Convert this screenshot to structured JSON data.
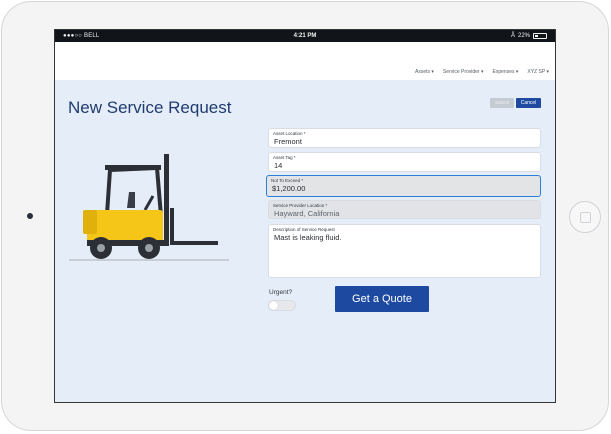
{
  "status_bar": {
    "carrier": "●●●○○ BELL",
    "time": "4:21 PM",
    "battery": "22%"
  },
  "nav": {
    "items": [
      "Assets",
      "Service Provider",
      "Expenses",
      "XYZ SP"
    ]
  },
  "page": {
    "title": "New Service Request",
    "submit_label": "Submit",
    "cancel_label": "Cancel"
  },
  "form": {
    "asset_location": {
      "label": "Asset Location *",
      "value": "Fremont"
    },
    "asset_tag": {
      "label": "Asset Tag *",
      "value": "14"
    },
    "not_to_exceed": {
      "label": "Not To Exceed *",
      "value": "$1,200.00"
    },
    "provider_location": {
      "label": "Service Provider Location *",
      "value": "Hayward, California"
    },
    "description": {
      "label": "Description of Service Request",
      "value": "Mast is leaking fluid."
    },
    "urgent_label": "Urgent?",
    "urgent": false,
    "quote_button": "Get a Quote"
  },
  "colors": {
    "accent": "#1d4aa0",
    "title": "#1f3b6e",
    "screen_bg": "#e5eef8",
    "forklift_body": "#f5c518",
    "forklift_dark": "#2c2f36"
  },
  "illustration": "forklift"
}
